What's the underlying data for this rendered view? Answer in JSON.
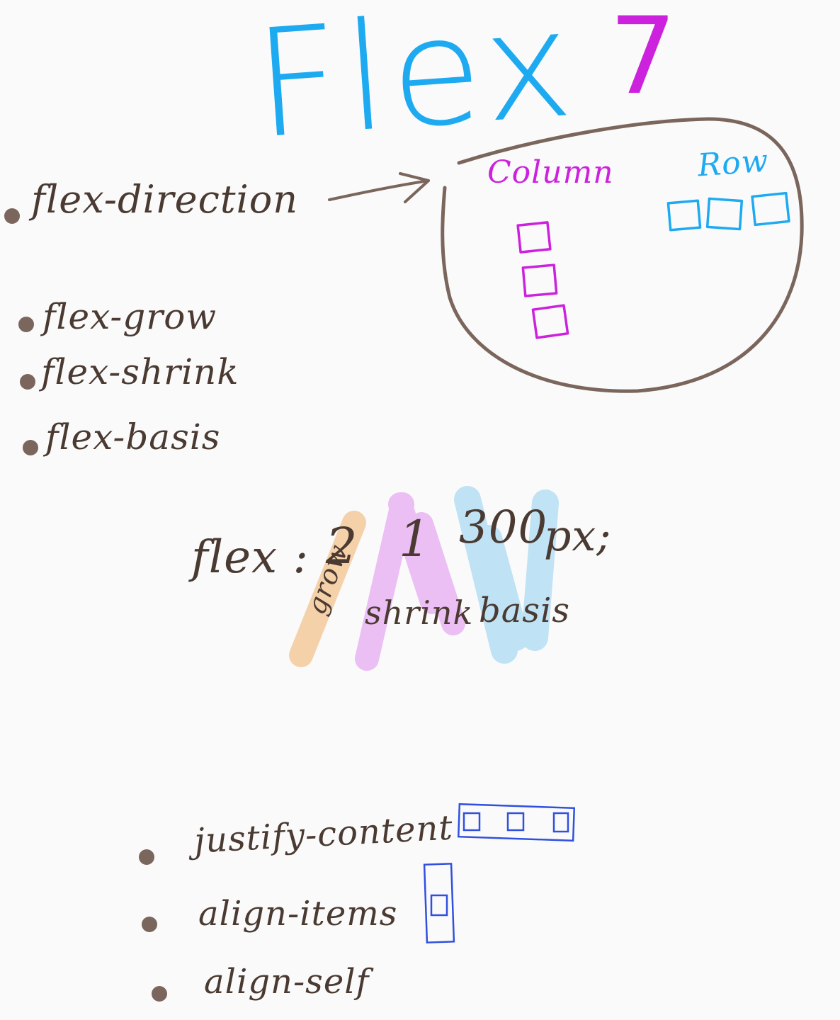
{
  "title": {
    "main": "Flex",
    "number": "7"
  },
  "direction": {
    "label": "flex-direction",
    "column_label": "Column",
    "row_label": "Row"
  },
  "properties": [
    "flex-grow",
    "flex-shrink",
    "flex-basis"
  ],
  "shorthand": {
    "prefix": "flex :",
    "grow_value": "2",
    "shrink_value": "1",
    "basis_value": "300",
    "suffix": "px;",
    "grow_label": "grow",
    "shrink_label": "shrink",
    "basis_label": "basis"
  },
  "alignment": [
    "justify-content",
    "align-items",
    "align-self"
  ],
  "colors": {
    "ink": "#4a3a32",
    "title": "#1eaaf1",
    "number": "#cc22dd",
    "column": "#cc22dd",
    "row": "#1eaaf1",
    "grow_highlight": "#f2b06a",
    "shrink_highlight": "#e08ef0",
    "basis_highlight": "#8fd0f2",
    "alignment_boxes": "#3050e0",
    "outline": "#7a665c"
  }
}
